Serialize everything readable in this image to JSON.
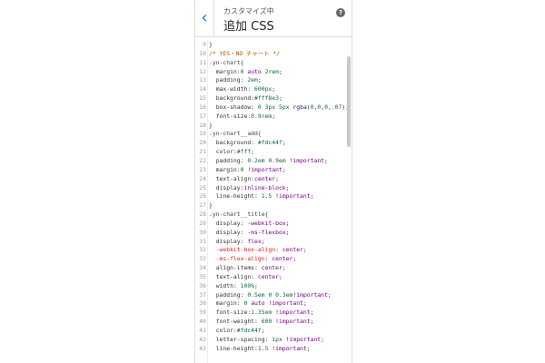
{
  "header": {
    "back_icon": "chevron-left-icon",
    "back_glyph": "‹",
    "subtitle": "カスタマイズ中",
    "title": "追加 CSS",
    "help_glyph": "?"
  },
  "colors": {
    "accent": "#2271b1",
    "comment": "#aa5500",
    "number": "#116644",
    "keyword": "#770088",
    "error_property": "#dd2222"
  },
  "editor": {
    "lines": [
      {
        "n": "9",
        "t": [
          [
            "tok-plain",
            "}"
          ]
        ]
      },
      {
        "n": "10",
        "t": [
          [
            "tok-comment",
            "/* YES・NO チャート */"
          ]
        ]
      },
      {
        "n": "11",
        "t": [
          [
            "tok-selector",
            ".yn-chart{"
          ]
        ]
      },
      {
        "n": "12",
        "t": [
          [
            "tok-prop",
            "  margin:"
          ],
          [
            "tok-num",
            "0"
          ],
          [
            "tok-plain",
            " "
          ],
          [
            "tok-keyword",
            "auto"
          ],
          [
            "tok-plain",
            " "
          ],
          [
            "tok-num",
            "2rem"
          ],
          [
            "tok-plain",
            ";"
          ]
        ]
      },
      {
        "n": "13",
        "t": [
          [
            "tok-prop",
            "  padding: "
          ],
          [
            "tok-num",
            "2em"
          ],
          [
            "tok-plain",
            ";"
          ]
        ]
      },
      {
        "n": "14",
        "t": [
          [
            "tok-prop",
            "  max-width: "
          ],
          [
            "tok-num",
            "600px"
          ],
          [
            "tok-plain",
            ";"
          ]
        ]
      },
      {
        "n": "15",
        "t": [
          [
            "tok-prop",
            "  background:"
          ],
          [
            "tok-color",
            "#fff8e3"
          ],
          [
            "tok-plain",
            ";"
          ]
        ]
      },
      {
        "n": "16",
        "t": [
          [
            "tok-prop",
            "  box-shadow: "
          ],
          [
            "tok-num",
            "0"
          ],
          [
            "tok-plain",
            " "
          ],
          [
            "tok-num",
            "3px"
          ],
          [
            "tok-plain",
            " "
          ],
          [
            "tok-num",
            "5px"
          ],
          [
            "tok-plain",
            " "
          ],
          [
            "tok-atom",
            "rgba"
          ],
          [
            "tok-plain",
            "("
          ],
          [
            "tok-num",
            "0"
          ],
          [
            "tok-plain",
            ","
          ],
          [
            "tok-num",
            "0"
          ],
          [
            "tok-plain",
            ","
          ],
          [
            "tok-num",
            "0"
          ],
          [
            "tok-plain",
            ","
          ],
          [
            "tok-num",
            ".07"
          ],
          [
            "tok-plain",
            ");"
          ]
        ]
      },
      {
        "n": "17",
        "t": [
          [
            "tok-prop",
            "  font-size:"
          ],
          [
            "tok-num",
            "0.9rem"
          ],
          [
            "tok-plain",
            ";"
          ]
        ]
      },
      {
        "n": "18",
        "t": [
          [
            "tok-plain",
            "}"
          ]
        ]
      },
      {
        "n": "19",
        "t": [
          [
            "tok-selector",
            ".yn-chart__add{"
          ]
        ]
      },
      {
        "n": "20",
        "t": [
          [
            "tok-prop",
            "  background: "
          ],
          [
            "tok-color",
            "#fdc44f"
          ],
          [
            "tok-plain",
            ";"
          ]
        ]
      },
      {
        "n": "21",
        "t": [
          [
            "tok-prop",
            "  color:"
          ],
          [
            "tok-color",
            "#fff"
          ],
          [
            "tok-plain",
            ";"
          ]
        ]
      },
      {
        "n": "22",
        "t": [
          [
            "tok-prop",
            "  padding: "
          ],
          [
            "tok-num",
            "0.2em"
          ],
          [
            "tok-plain",
            " "
          ],
          [
            "tok-num",
            "0.9em"
          ],
          [
            "tok-plain",
            " "
          ],
          [
            "tok-important",
            "!important"
          ],
          [
            "tok-plain",
            ";"
          ]
        ]
      },
      {
        "n": "23",
        "t": [
          [
            "tok-prop",
            "  margin:"
          ],
          [
            "tok-num",
            "0"
          ],
          [
            "tok-plain",
            " "
          ],
          [
            "tok-important",
            "!important"
          ],
          [
            "tok-plain",
            ";"
          ]
        ]
      },
      {
        "n": "24",
        "t": [
          [
            "tok-prop",
            "  text-align:"
          ],
          [
            "tok-keyword",
            "center"
          ],
          [
            "tok-plain",
            ";"
          ]
        ]
      },
      {
        "n": "25",
        "t": [
          [
            "tok-prop",
            "  display:"
          ],
          [
            "tok-keyword",
            "inline-block"
          ],
          [
            "tok-plain",
            ";"
          ]
        ]
      },
      {
        "n": "26",
        "t": [
          [
            "tok-prop",
            "  line-height: "
          ],
          [
            "tok-num",
            "1.5"
          ],
          [
            "tok-plain",
            " "
          ],
          [
            "tok-important",
            "!important"
          ],
          [
            "tok-plain",
            ";"
          ]
        ]
      },
      {
        "n": "27",
        "t": [
          [
            "tok-plain",
            "}"
          ]
        ]
      },
      {
        "n": "28",
        "t": [
          [
            "tok-selector",
            ".yn-chart__title{"
          ]
        ]
      },
      {
        "n": "29",
        "t": [
          [
            "tok-prop",
            "  display: "
          ],
          [
            "tok-keyword",
            "-webkit-box"
          ],
          [
            "tok-plain",
            ";"
          ]
        ]
      },
      {
        "n": "30",
        "t": [
          [
            "tok-prop",
            "  display: "
          ],
          [
            "tok-keyword",
            "-ms-flexbox"
          ],
          [
            "tok-plain",
            ";"
          ]
        ]
      },
      {
        "n": "31",
        "t": [
          [
            "tok-prop",
            "  display: "
          ],
          [
            "tok-keyword",
            "flex"
          ],
          [
            "tok-plain",
            ";"
          ]
        ]
      },
      {
        "n": "32",
        "t": [
          [
            "tok-bad-prop",
            "  -webkit-box-align"
          ],
          [
            "tok-plain",
            ": "
          ],
          [
            "tok-keyword",
            "center"
          ],
          [
            "tok-plain",
            ";"
          ]
        ]
      },
      {
        "n": "33",
        "t": [
          [
            "tok-bad-prop",
            "  -ms-flex-align"
          ],
          [
            "tok-plain",
            ": "
          ],
          [
            "tok-keyword",
            "center"
          ],
          [
            "tok-plain",
            ";"
          ]
        ]
      },
      {
        "n": "34",
        "t": [
          [
            "tok-prop",
            "  align-items: "
          ],
          [
            "tok-keyword",
            "center"
          ],
          [
            "tok-plain",
            ";"
          ]
        ]
      },
      {
        "n": "35",
        "t": [
          [
            "tok-prop",
            "  text-align: "
          ],
          [
            "tok-keyword",
            "center"
          ],
          [
            "tok-plain",
            ";"
          ]
        ]
      },
      {
        "n": "36",
        "t": [
          [
            "tok-prop",
            "  width: "
          ],
          [
            "tok-num",
            "100%"
          ],
          [
            "tok-plain",
            ";"
          ]
        ]
      },
      {
        "n": "37",
        "t": [
          [
            "tok-prop",
            "  padding: "
          ],
          [
            "tok-num",
            "0.5em"
          ],
          [
            "tok-plain",
            " "
          ],
          [
            "tok-num",
            "0"
          ],
          [
            "tok-plain",
            " "
          ],
          [
            "tok-num",
            "0.3em"
          ],
          [
            "tok-important",
            "!important"
          ],
          [
            "tok-plain",
            ";"
          ]
        ]
      },
      {
        "n": "38",
        "t": [
          [
            "tok-prop",
            "  margin: "
          ],
          [
            "tok-num",
            "0"
          ],
          [
            "tok-plain",
            " "
          ],
          [
            "tok-keyword",
            "auto"
          ],
          [
            "tok-plain",
            " "
          ],
          [
            "tok-important",
            "!important"
          ],
          [
            "tok-plain",
            ";"
          ]
        ]
      },
      {
        "n": "39",
        "t": [
          [
            "tok-prop",
            "  font-size:"
          ],
          [
            "tok-num",
            "1.35em"
          ],
          [
            "tok-plain",
            " "
          ],
          [
            "tok-important",
            "!important"
          ],
          [
            "tok-plain",
            ";"
          ]
        ]
      },
      {
        "n": "40",
        "t": [
          [
            "tok-prop",
            "  font-weight: "
          ],
          [
            "tok-num",
            "600"
          ],
          [
            "tok-plain",
            " "
          ],
          [
            "tok-important",
            "!important"
          ],
          [
            "tok-plain",
            ";"
          ]
        ]
      },
      {
        "n": "41",
        "t": [
          [
            "tok-prop",
            "  color:"
          ],
          [
            "tok-color",
            "#fdc44f"
          ],
          [
            "tok-plain",
            ";"
          ]
        ]
      },
      {
        "n": "42",
        "t": [
          [
            "tok-prop",
            "  letter-spacing: "
          ],
          [
            "tok-num",
            "1px"
          ],
          [
            "tok-plain",
            " "
          ],
          [
            "tok-important",
            "!important"
          ],
          [
            "tok-plain",
            ";"
          ]
        ]
      },
      {
        "n": "43",
        "t": [
          [
            "tok-prop",
            "  line-height:"
          ],
          [
            "tok-num",
            "1.5"
          ],
          [
            "tok-plain",
            " "
          ],
          [
            "tok-important",
            "!important"
          ],
          [
            "tok-plain",
            ";"
          ]
        ]
      }
    ]
  }
}
